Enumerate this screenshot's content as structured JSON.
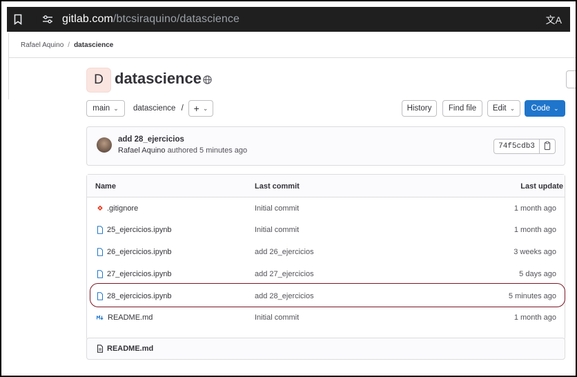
{
  "browser": {
    "url_host": "gitlab.com",
    "url_path": "/btcsiraquino/datascience"
  },
  "breadcrumb": {
    "owner": "Rafael Aquino",
    "separator": "/",
    "project": "datascience"
  },
  "project": {
    "avatar_letter": "D",
    "title": "datascience"
  },
  "toolbar": {
    "branch": "main",
    "path": "datascience",
    "path_sep": "/",
    "add_label": "+",
    "history": "History",
    "find_file": "Find file",
    "edit": "Edit",
    "code": "Code",
    "code_color": "#1f75cb"
  },
  "last_commit": {
    "message": "add 28_ejercicios",
    "author": "Rafael Aquino",
    "action": "authored 5 minutes ago",
    "sha": "74f5cdb3"
  },
  "files": {
    "headers": {
      "name": "Name",
      "last_commit": "Last commit",
      "last_update": "Last update"
    },
    "rows": [
      {
        "name": ".gitignore",
        "icon": "git-icon",
        "commit": "Initial commit",
        "updated": "1 month ago"
      },
      {
        "name": "25_ejercicios.ipynb",
        "icon": "file-icon",
        "commit": "Initial commit",
        "updated": "1 month ago"
      },
      {
        "name": "26_ejercicios.ipynb",
        "icon": "file-icon",
        "commit": "add 26_ejercicios",
        "updated": "3 weeks ago"
      },
      {
        "name": "27_ejercicios.ipynb",
        "icon": "file-icon",
        "commit": "add 27_ejercicios",
        "updated": "5 days ago"
      },
      {
        "name": "28_ejercicios.ipynb",
        "icon": "file-icon",
        "commit": "add 28_ejercicios",
        "updated": "5 minutes ago",
        "highlighted": true
      },
      {
        "name": "README.md",
        "icon": "markdown-icon",
        "commit": "Initial commit",
        "updated": "1 month ago"
      }
    ]
  },
  "readme": {
    "title": "README.md"
  },
  "colors": {
    "highlight_outline": "#7a1624",
    "git_icon": "#e24329",
    "file_icon": "#1f75cb"
  }
}
